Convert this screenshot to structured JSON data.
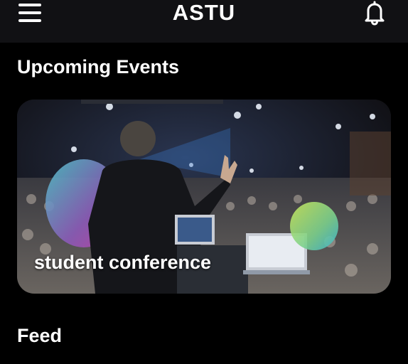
{
  "header": {
    "title": "ASTU",
    "menu_icon": "hamburger-menu-icon",
    "notification_icon": "bell-icon"
  },
  "upcoming": {
    "heading": "Upcoming Events",
    "events": [
      {
        "title": "student conference"
      }
    ]
  },
  "feed": {
    "heading": "Feed"
  },
  "colors": {
    "background": "#000000",
    "app_bar": "#111114",
    "text": "#ffffff"
  }
}
